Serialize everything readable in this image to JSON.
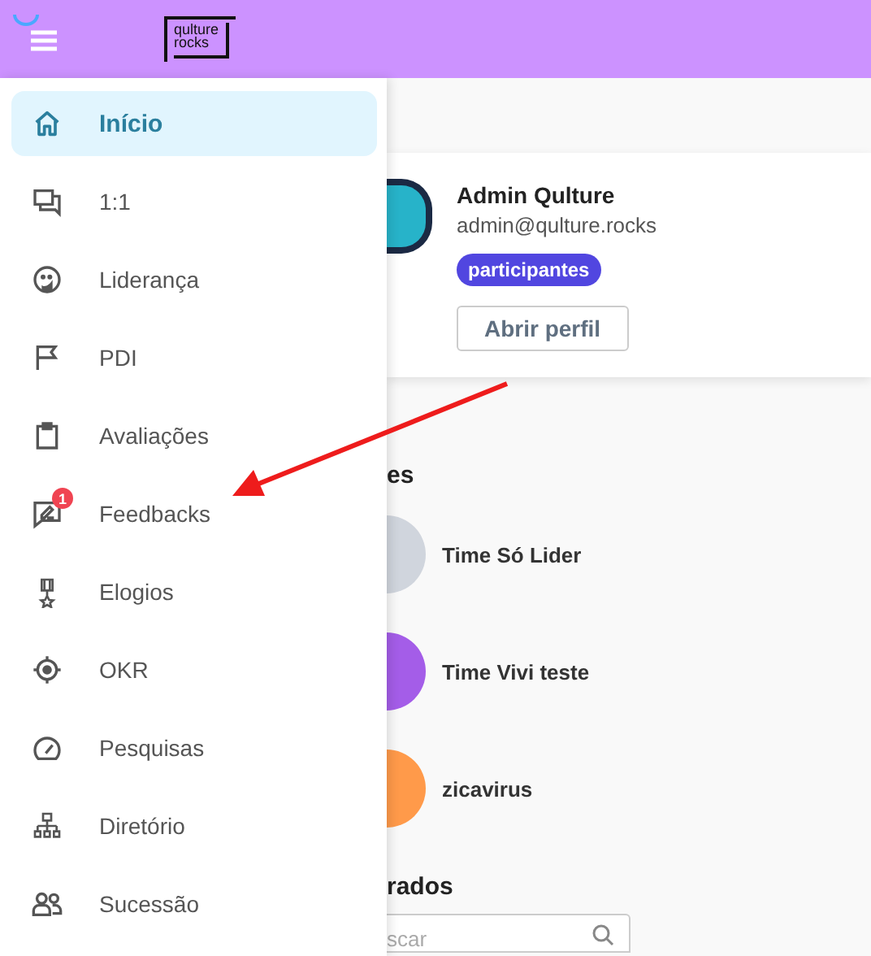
{
  "top_bar": {
    "logo_lines": [
      "qulture",
      "rocks"
    ]
  },
  "nav": [
    {
      "label": "Início",
      "selected": true
    },
    {
      "label": "1:1",
      "selected": false
    },
    {
      "label": "Liderança",
      "selected": false
    },
    {
      "label": "PDI",
      "selected": false
    },
    {
      "label": "Avaliações",
      "selected": false
    },
    {
      "label": "Feedbacks",
      "selected": false,
      "badge": "1"
    },
    {
      "label": "Elogios",
      "selected": false
    },
    {
      "label": "OKR",
      "selected": false
    },
    {
      "label": "Pesquisas",
      "selected": false
    },
    {
      "label": "Diretório",
      "selected": false
    },
    {
      "label": "Sucessão",
      "selected": false
    }
  ],
  "profile": {
    "name": "Admin Qulture",
    "email": "admin@qulture.rocks",
    "tag": "participantes",
    "button": "Abrir perfil"
  },
  "teams": {
    "heading": "es",
    "items": [
      {
        "name": "Time Só Lider",
        "color": "#d0d5dd"
      },
      {
        "name": "Time Vivi teste",
        "color": "#a45de8"
      },
      {
        "name": "zicavirus",
        "color": "#ff9a4a"
      }
    ]
  },
  "second_section": {
    "heading": "rados",
    "search": {
      "placeholder": "scar"
    }
  }
}
